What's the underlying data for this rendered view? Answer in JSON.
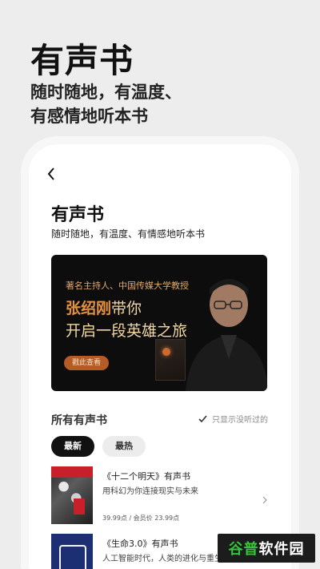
{
  "hero": {
    "title": "有声书",
    "subtitle_line1": "随时随地，有温度、",
    "subtitle_line2": "有感情地听本书"
  },
  "page": {
    "title": "有声书",
    "description": "随时随地，有温度、有情感地听本书"
  },
  "banner": {
    "line1": "著名主持人、中国传媒大学教授",
    "name": "张绍刚",
    "name_suffix": "带你",
    "line3": "开启一段英雄之旅",
    "button_label": "戳此查看"
  },
  "section": {
    "title": "所有有声书",
    "filter_label": "只显示没听过的"
  },
  "tabs": [
    {
      "label": "最新",
      "active": true
    },
    {
      "label": "最热",
      "active": false
    }
  ],
  "books": [
    {
      "title": "《十二个明天》有声书",
      "description": "用科幻为你连接现实与未来",
      "price": "39.99点 / 会员价 23.99点"
    },
    {
      "title": "《生命3.0》有声书",
      "description": "人工智能时代，人类的进化与重生"
    }
  ],
  "watermark": {
    "prefix": "谷普",
    "suffix": "软件园"
  }
}
